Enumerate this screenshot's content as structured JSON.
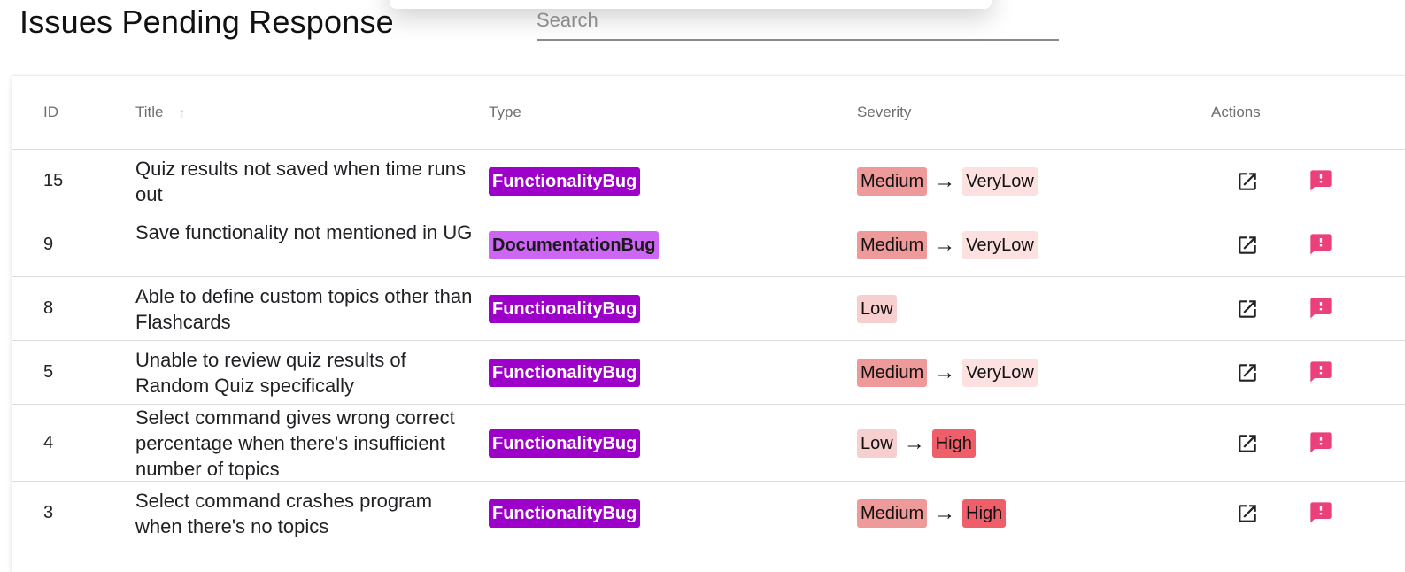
{
  "page": {
    "title": "Issues Pending Response",
    "search_placeholder": "Search",
    "search_value": ""
  },
  "table": {
    "columns": {
      "id": "ID",
      "title": "Title",
      "type": "Type",
      "severity": "Severity",
      "actions": "Actions"
    },
    "sort_icon": "arrow-up-icon",
    "rows": [
      {
        "id": "15",
        "title": "Quiz results not saved when time runs out",
        "type": "FunctionalityBug",
        "sev_from": "Medium",
        "sev_to": "VeryLow"
      },
      {
        "id": "9",
        "title": "Save functionality not mentioned in UG",
        "type": "DocumentationBug",
        "sev_from": "Medium",
        "sev_to": "VeryLow"
      },
      {
        "id": "8",
        "title": "Able to define custom topics other than Flashcards",
        "type": "FunctionalityBug",
        "sev_from": "Low",
        "sev_to": ""
      },
      {
        "id": "5",
        "title": "Unable to review quiz results of Random Quiz specifically",
        "type": "FunctionalityBug",
        "sev_from": "Medium",
        "sev_to": "VeryLow"
      },
      {
        "id": "4",
        "title": "Select command gives wrong correct percentage when there's insufficient number of topics",
        "type": "FunctionalityBug",
        "sev_from": "Low",
        "sev_to": "High"
      },
      {
        "id": "3",
        "title": "Select command crashes program when there's no topics",
        "type": "FunctionalityBug",
        "sev_from": "Medium",
        "sev_to": "High"
      }
    ],
    "severity_arrow": "→",
    "action_icons": [
      "open-in-new-icon",
      "feedback-icon"
    ]
  },
  "colors": {
    "FunctionalityBug": "#9c00c9",
    "DocumentationBug": "#cd66f5",
    "DocumentationBugText": "#1a1a1a",
    "Medium": "#ef9a9a",
    "VeryLow": "#fde0e0",
    "Low": "#f8cfcf",
    "High": "#ef5f6a",
    "flag_icon": "#ec407a"
  }
}
